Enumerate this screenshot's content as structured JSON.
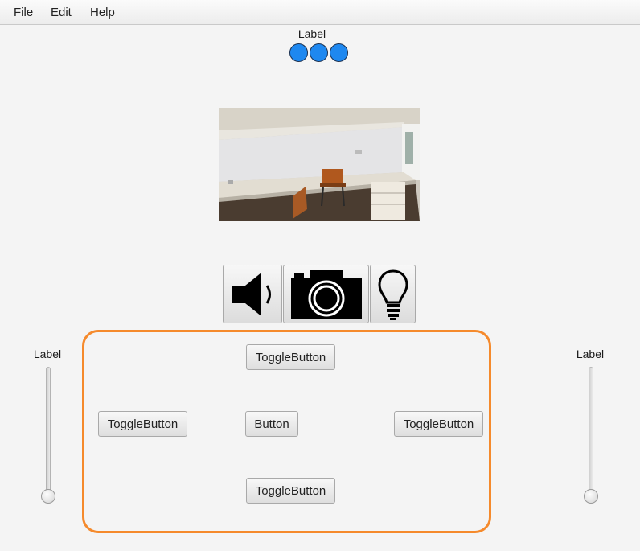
{
  "menu": {
    "file": "File",
    "edit": "Edit",
    "help": "Help"
  },
  "top_label": "Label",
  "indicators": {
    "count": 3,
    "color": "#1e88f0"
  },
  "image": {
    "description_icon": "photo"
  },
  "icon_buttons": [
    {
      "icon": "speaker-icon"
    },
    {
      "icon": "camera-icon"
    },
    {
      "icon": "lightbulb-icon"
    }
  ],
  "panel": {
    "border_color": "#f58a2c",
    "toggle_top": "ToggleButton",
    "toggle_left": "ToggleButton",
    "center_button": "Button",
    "toggle_right": "ToggleButton",
    "toggle_bottom": "ToggleButton"
  },
  "left_slider": {
    "label": "Label",
    "value": 0
  },
  "right_slider": {
    "label": "Label",
    "value": 0
  }
}
